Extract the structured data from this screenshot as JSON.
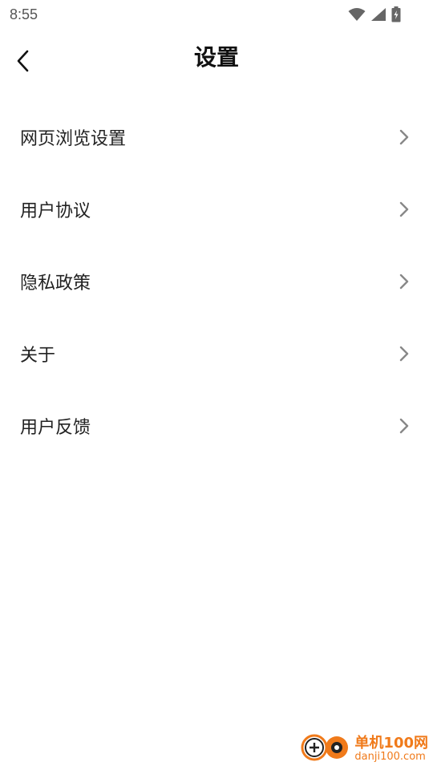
{
  "status_bar": {
    "time": "8:55"
  },
  "header": {
    "title": "设置"
  },
  "settings": {
    "items": [
      {
        "label": "网页浏览设置"
      },
      {
        "label": "用户协议"
      },
      {
        "label": "隐私政策"
      },
      {
        "label": "关于"
      },
      {
        "label": "用户反馈"
      }
    ]
  },
  "watermark": {
    "name": "单机100网",
    "domain": "danji100.com"
  },
  "colors": {
    "background": "#ffffff",
    "text": "#222222",
    "chevron": "#888888",
    "watermark": "#f07a1a"
  },
  "icons": {
    "back": "chevron-left-icon",
    "item_arrow": "chevron-right-icon",
    "wifi": "wifi-icon",
    "signal": "signal-icon",
    "battery": "battery-icon"
  }
}
